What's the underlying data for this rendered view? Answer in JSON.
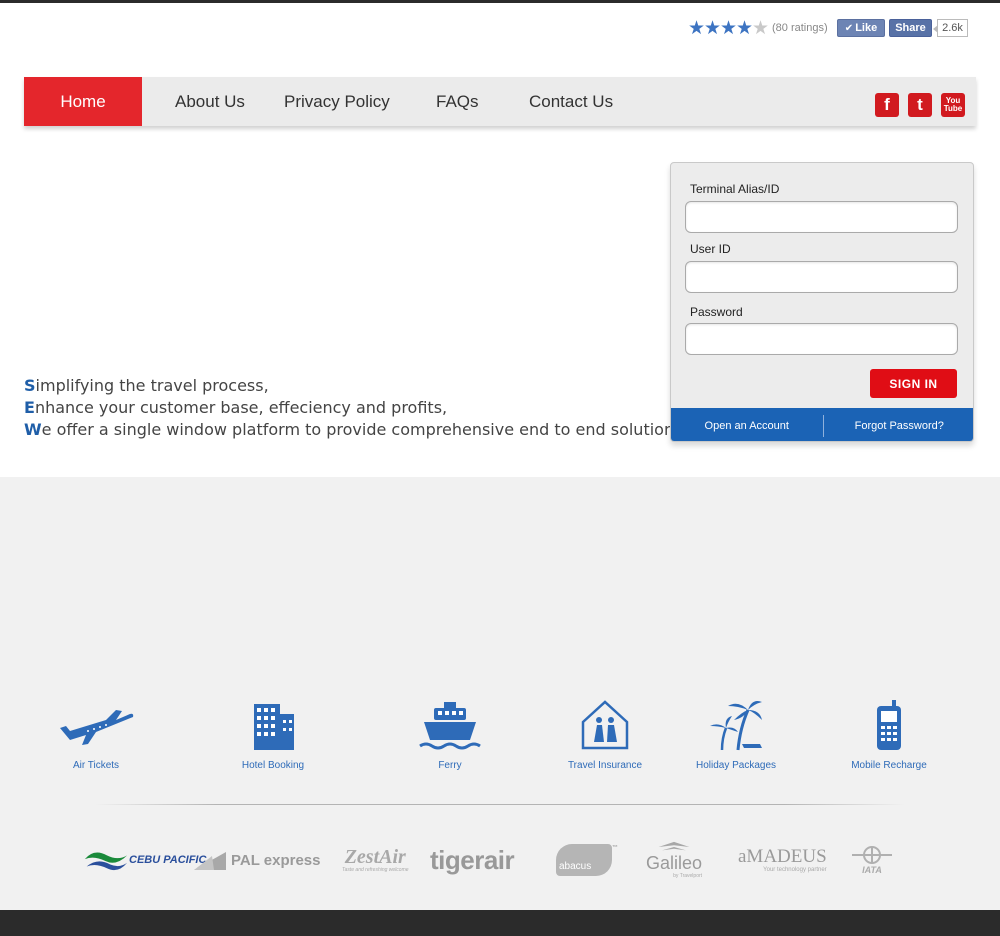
{
  "rating": {
    "stars": 4,
    "max_stars": 5,
    "count_text": "(80 ratings)"
  },
  "facebook": {
    "like_label": "Like",
    "share_label": "Share",
    "count": "2.6k"
  },
  "nav": {
    "items": [
      "Home",
      "About Us",
      "Privacy Policy",
      "FAQs",
      "Contact Us"
    ],
    "active": "Home"
  },
  "social": [
    "facebook-icon",
    "twitter-icon",
    "youtube-icon"
  ],
  "tagline": {
    "lines": [
      {
        "cap": "S",
        "rest": "implifying the travel process,"
      },
      {
        "cap": "E",
        "rest": "nhance your customer base, effeciency and profits,"
      },
      {
        "cap": "W",
        "rest": "e offer a single window platform to provide comprehensive end to end solution."
      }
    ]
  },
  "login": {
    "terminal_label": "Terminal Alias/ID",
    "terminal_value": "",
    "user_label": "User ID",
    "user_value": "",
    "password_label": "Password",
    "password_value": "",
    "signin_label": "SIGN IN",
    "open_account": "Open an Account",
    "forgot_password": "Forgot Password?"
  },
  "services": [
    {
      "label": "Air Tickets",
      "icon": "airplane-icon"
    },
    {
      "label": "Hotel Booking",
      "icon": "building-icon"
    },
    {
      "label": "Ferry",
      "icon": "ferry-icon"
    },
    {
      "label": "Travel Insurance",
      "icon": "family-house-icon"
    },
    {
      "label": "Holiday Packages",
      "icon": "palm-tree-icon"
    },
    {
      "label": "Mobile Recharge",
      "icon": "mobile-phone-icon"
    }
  ],
  "partners": [
    "CEBU PACIFIC",
    "PAL express",
    "ZestAir",
    "tigerair",
    "abacus",
    "Galileo",
    "aMADEUS",
    "IATA"
  ],
  "partner_taglines": {
    "amadeus": "Your technology partner",
    "galileo": "by Travelport",
    "zestair": "Taste and refreshing welcome"
  },
  "colors": {
    "accent_red": "#e4262c",
    "accent_blue": "#1b63b5",
    "icon_blue": "#2e6bb8"
  }
}
